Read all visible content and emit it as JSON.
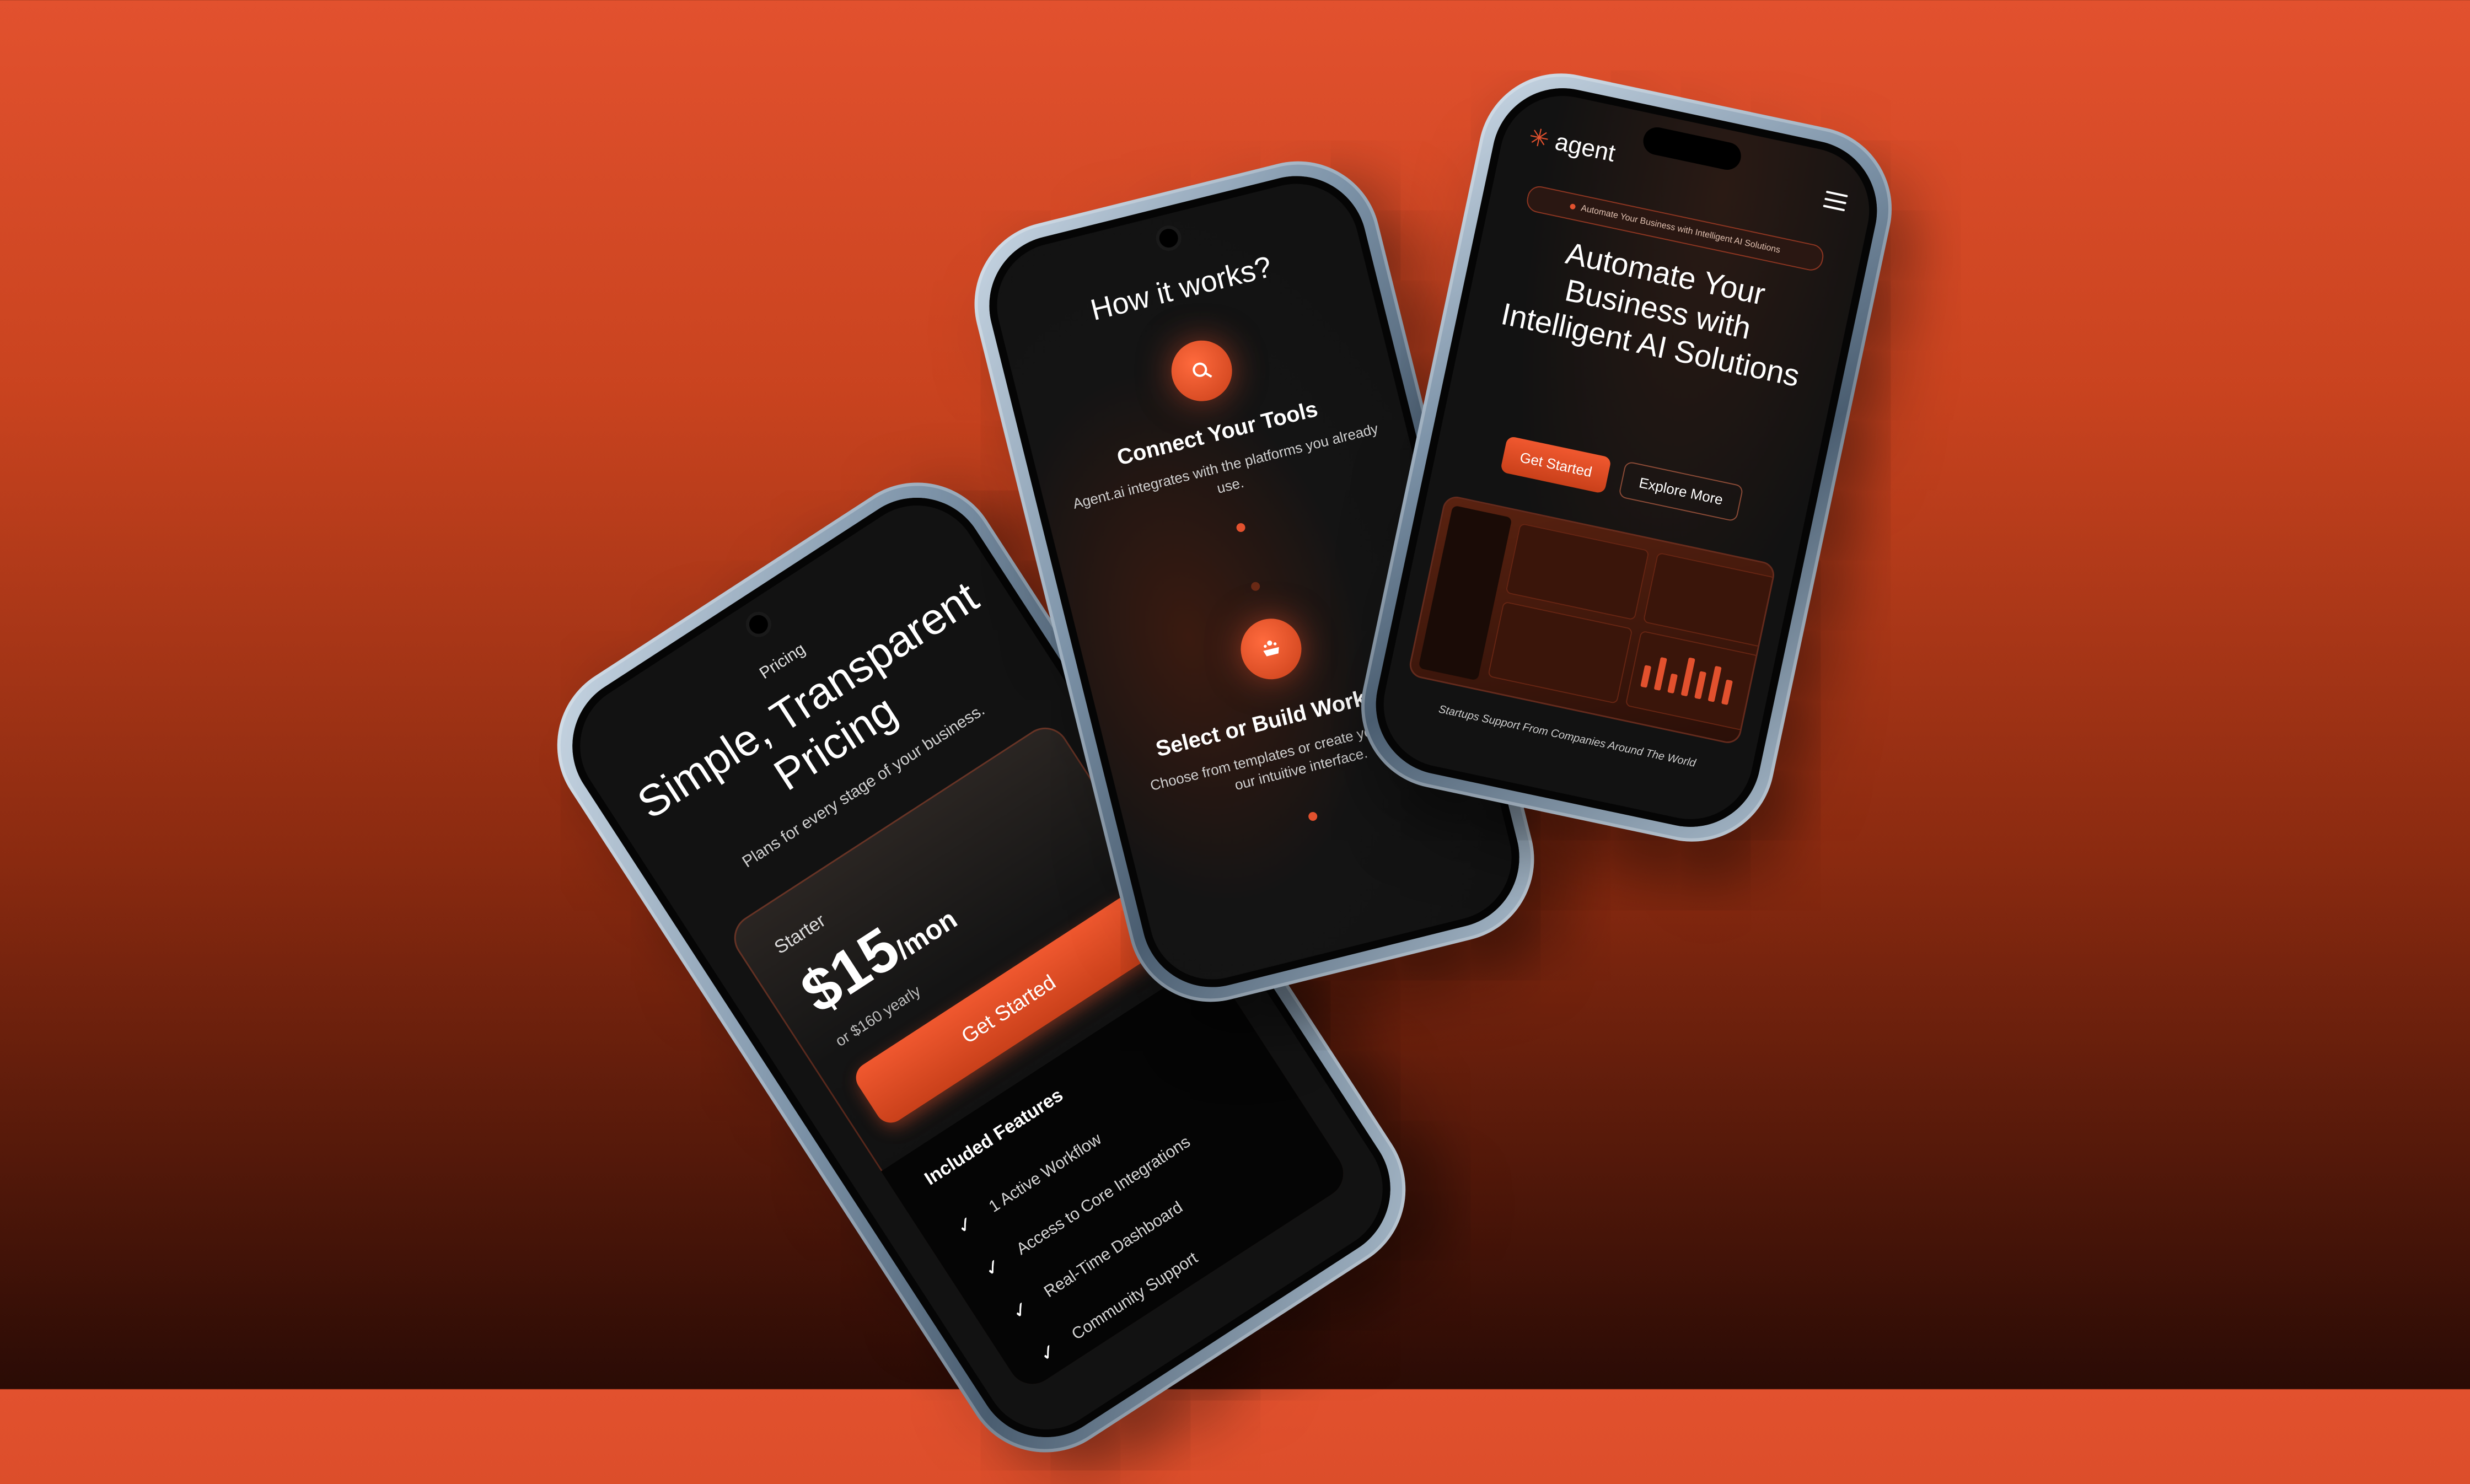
{
  "pricing_screen": {
    "eyebrow": "Pricing",
    "title": "Simple, Transparent Pricing",
    "subtitle": "Plans for every stage of your business.",
    "plan": {
      "name": "Starter",
      "price": "$15",
      "period": "/mon",
      "yearly": "or $160 yearly",
      "cta": "Get Started"
    },
    "features_title": "Included Features",
    "features": [
      "1 Active Workflow",
      "Access to Core Integrations",
      "Real-Time Dashboard",
      "Community Support"
    ]
  },
  "how_screen": {
    "title": "How it works?",
    "steps": [
      {
        "icon": "search-icon",
        "title": "Connect Your Tools",
        "desc": "Agent.ai integrates with the platforms you already use."
      },
      {
        "icon": "workflow-icon",
        "title": "Select or Build Workflows",
        "desc": "Choose from templates or create your own with our intuitive interface."
      }
    ]
  },
  "hero_screen": {
    "logo_text": "agent",
    "badge": "Automate Your Business with Intelligent AI Solutions",
    "title": "Automate Your Business with Intelligent AI Solutions",
    "primary_cta": "Get Started",
    "secondary_cta": "Explore More",
    "trust_text": "Startups Support From Companies Around The World"
  },
  "colors": {
    "accent": "#e2512e",
    "background_top": "#e2512e",
    "background_bottom": "#2a0b05",
    "screen": "#121212"
  }
}
